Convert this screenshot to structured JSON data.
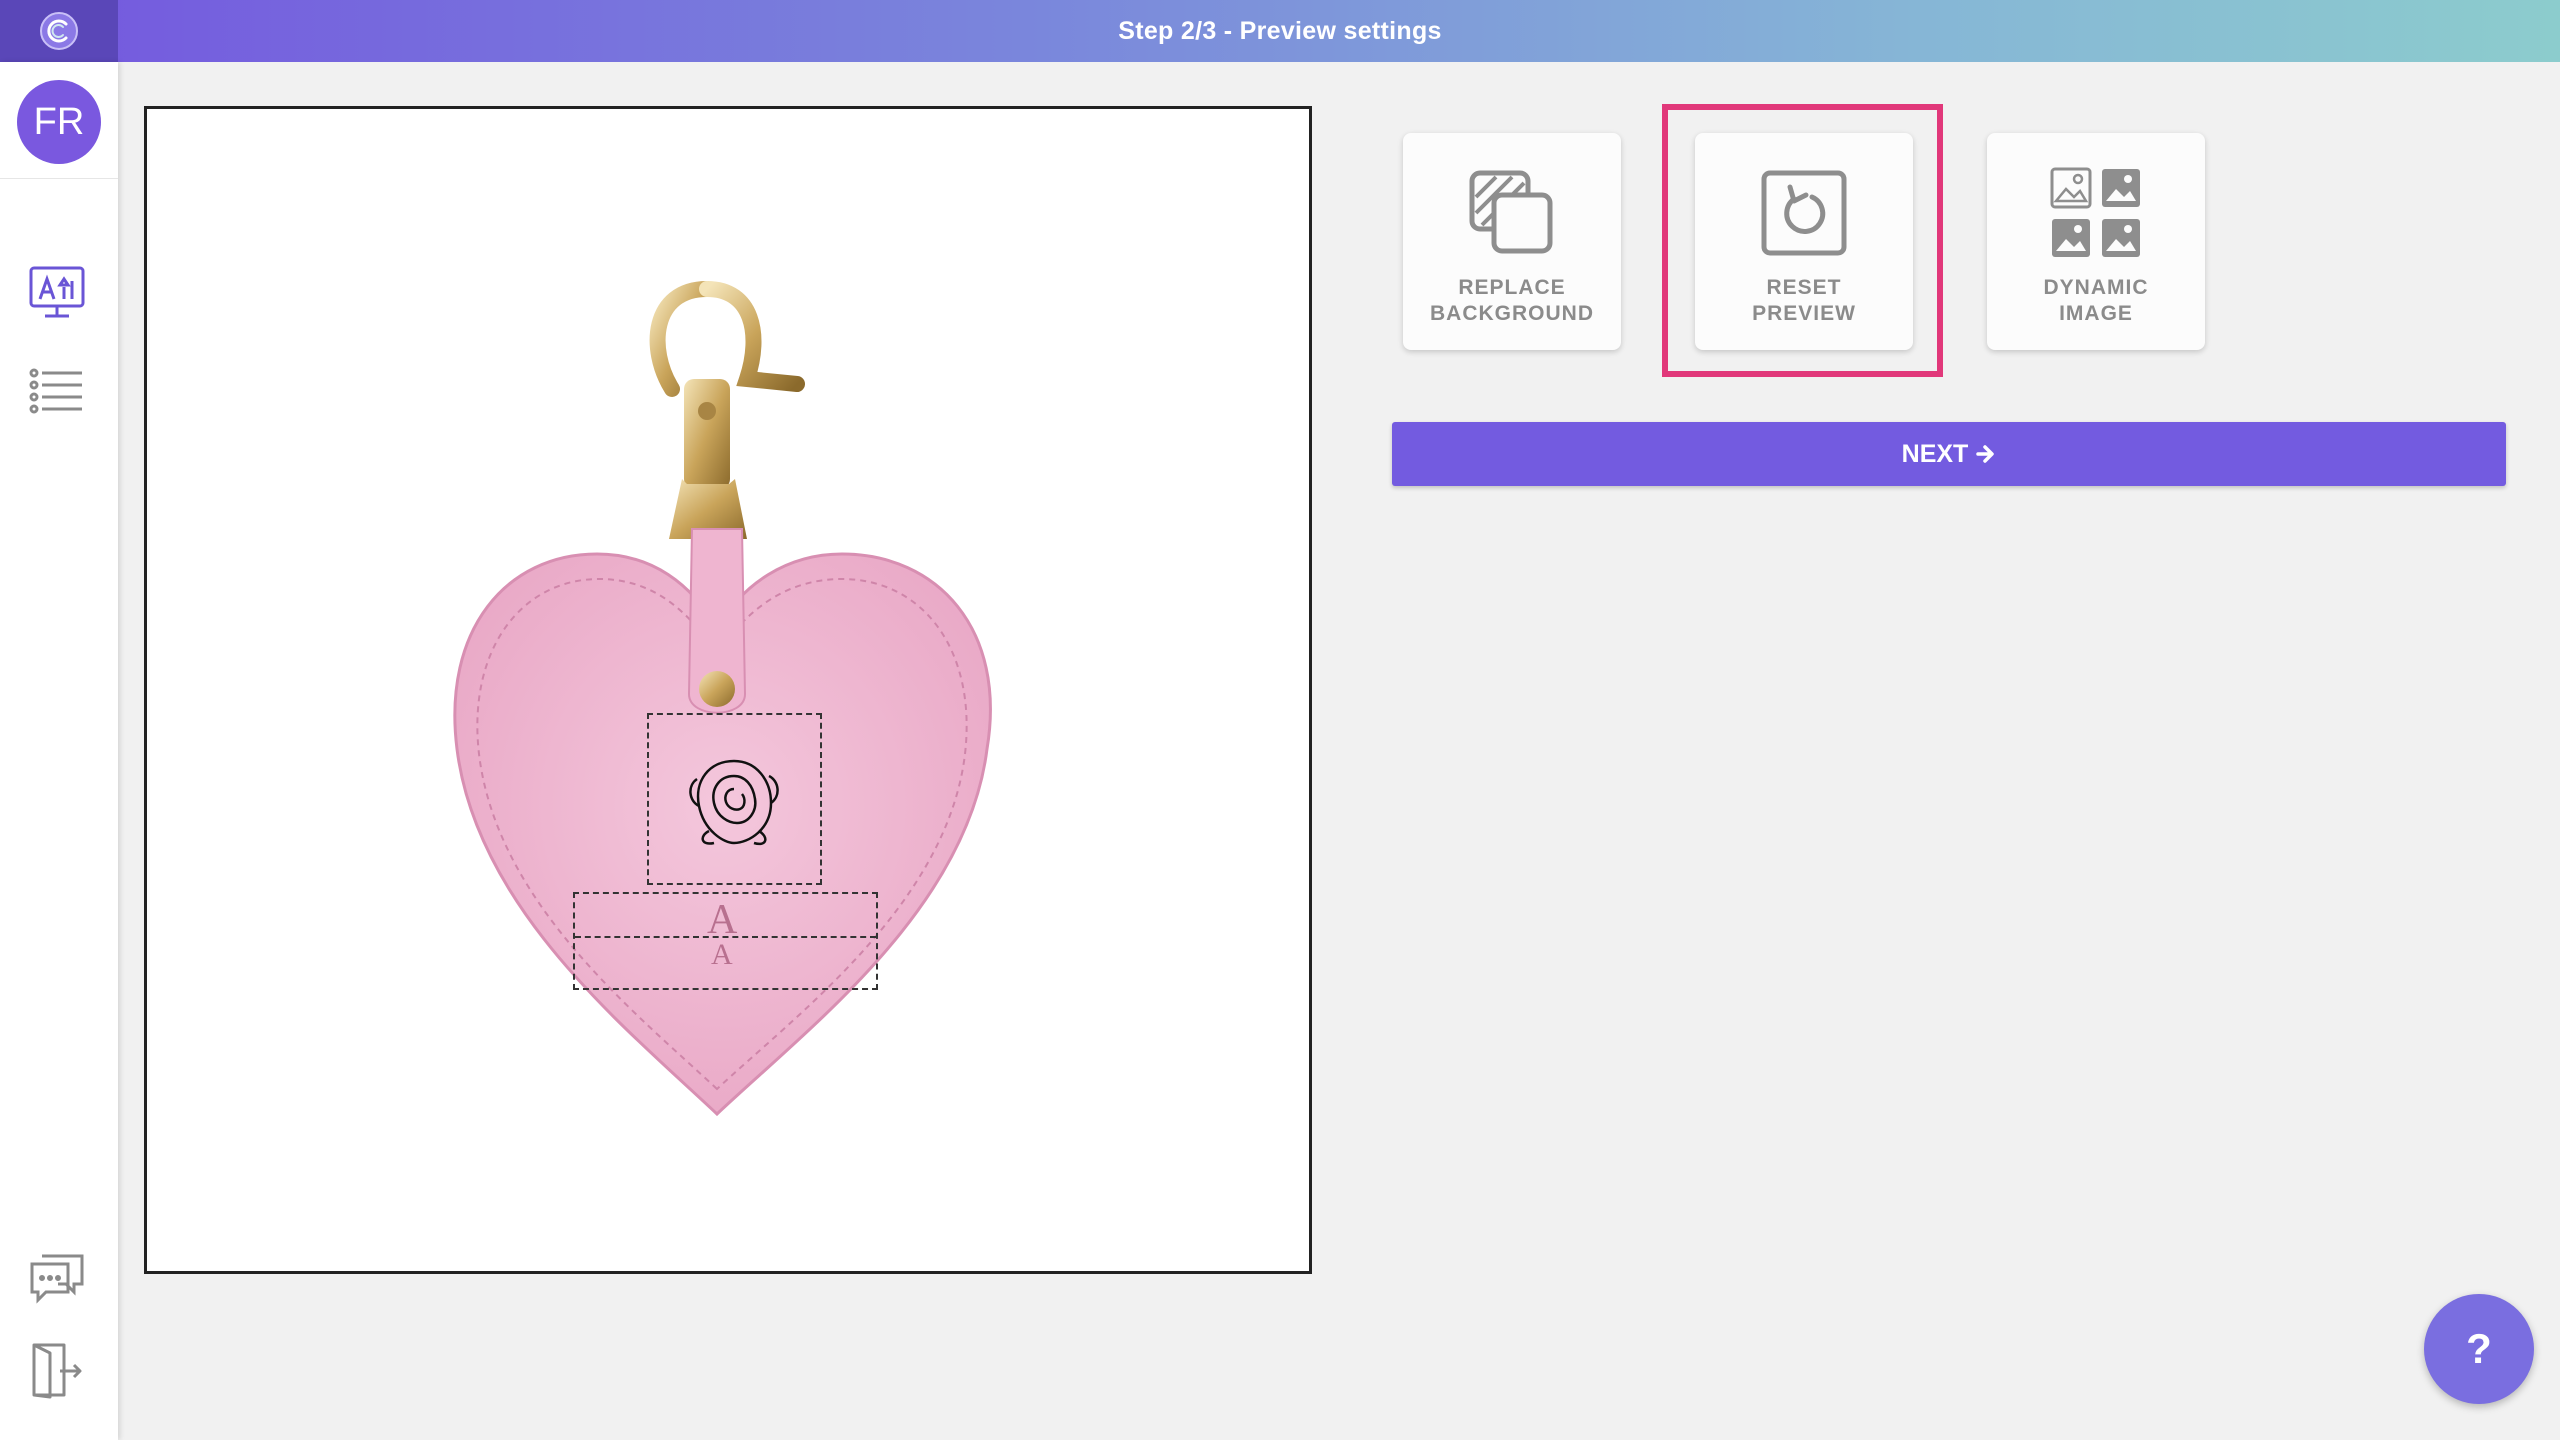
{
  "header": {
    "title": "Step 2/3 - Preview settings"
  },
  "sidebar": {
    "avatar_initials": "FR",
    "items": [
      {
        "icon": "design-monitor-icon"
      },
      {
        "icon": "list-icon"
      }
    ],
    "bottom_items": [
      {
        "icon": "chat-icon"
      },
      {
        "icon": "logout-icon"
      }
    ]
  },
  "preview": {
    "product": "pink heart leather keychain",
    "placeholders": [
      {
        "type": "image",
        "content": "rose-icon"
      },
      {
        "type": "text",
        "content": "A"
      }
    ]
  },
  "tools": [
    {
      "label": "REPLACE\nBACKGROUND",
      "icon": "replace-background-icon"
    },
    {
      "label": "RESET\nPREVIEW",
      "icon": "reset-icon",
      "highlighted": true
    },
    {
      "label": "DYNAMIC\nIMAGE",
      "icon": "image-grid-icon"
    }
  ],
  "next_button": {
    "label": "NEXT"
  },
  "help_button": {
    "label": "?"
  },
  "colors": {
    "accent": "#735be0",
    "highlight": "#e1387a",
    "avatar": "#7a58df"
  }
}
